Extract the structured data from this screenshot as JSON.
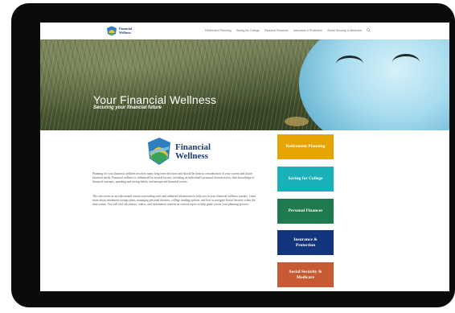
{
  "site": {
    "logo_line1": "Financial",
    "logo_line2": "Wellness"
  },
  "nav": {
    "items": [
      "Retirement Planning",
      "Saving for College",
      "Personal Finances",
      "Insurance & Protection",
      "Social Security & Medicare"
    ],
    "search_icon": "search-icon"
  },
  "hero": {
    "title": "Your Financial Wellness",
    "subtitle": "Securing your financial future"
  },
  "content": {
    "logo_line1": "Financial",
    "logo_line2": "Wellness",
    "paragraph1": "Planning for your financial wellness involves many long term decisions and should be done in consideration of your current and future financial needs. Financial wellness is influenced by several factors, including an individual's personal characteristics, their knowledge of financial concepts, spending and saving habits, and unexpected financial events.",
    "paragraph2": "This site serves as an educational resource providing tools and unbiased information to help you in your financial wellness journey. Learn more about retirement savings plans, managing personal finances, college funding options, and how to navigate Social Security when the time comes. You will find calculators, videos, and information content on various topics to help guide you in your planning process."
  },
  "tiles": [
    {
      "label": "Retirement Planning",
      "color": "#e6a400"
    },
    {
      "label": "Saving for College",
      "color": "#1ab0b8"
    },
    {
      "label": "Personal Finances",
      "color": "#1f7a4e"
    },
    {
      "label": "Insurance & Protection",
      "color": "#12357e"
    },
    {
      "label": "Social Security & Medicare",
      "color": "#c65a33"
    }
  ]
}
